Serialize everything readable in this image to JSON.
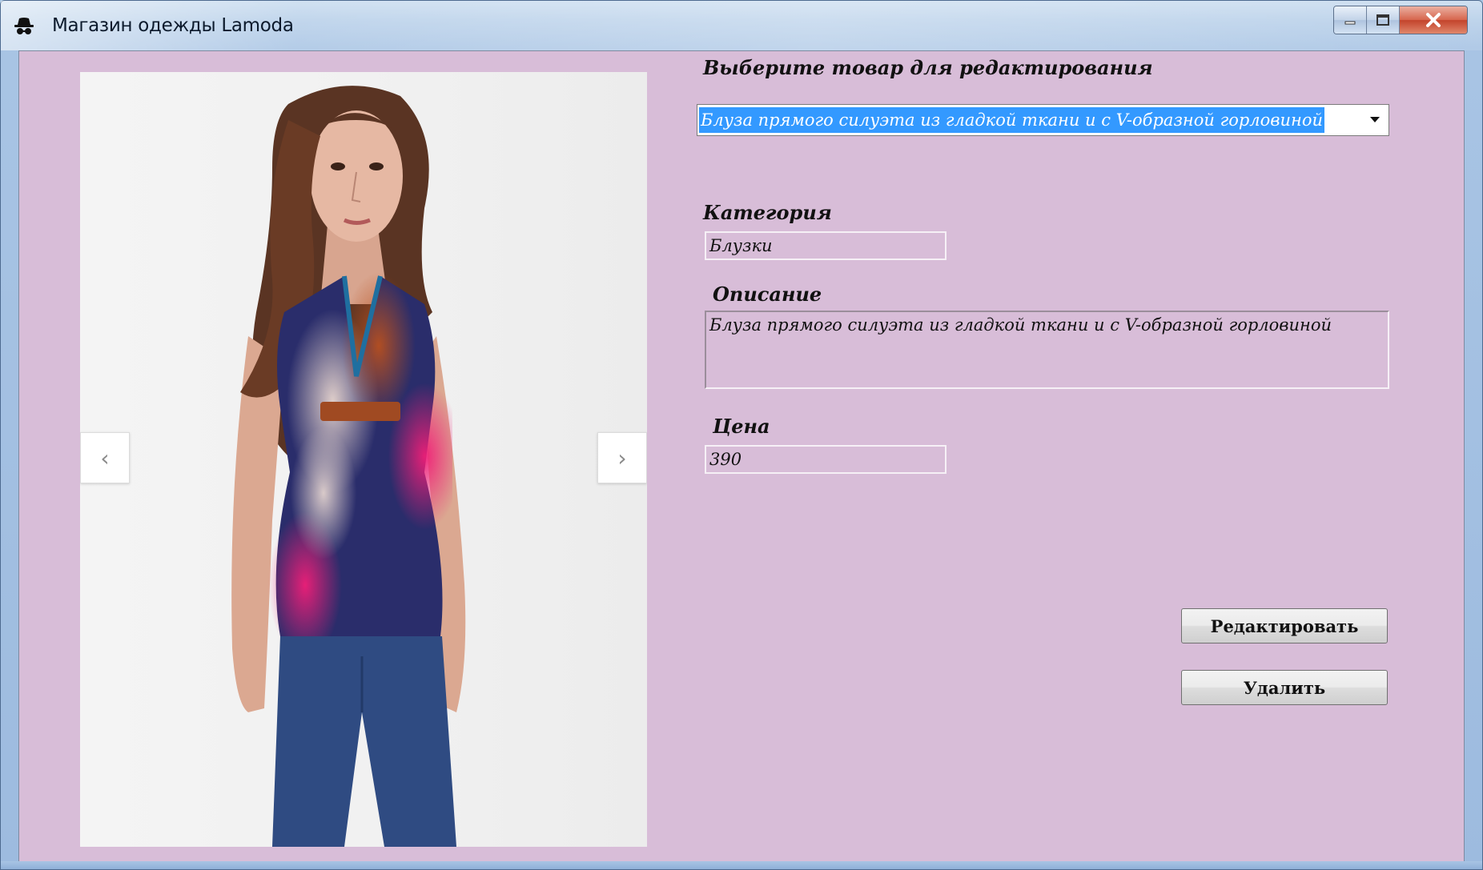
{
  "window": {
    "title": "Магазин одежды Lamoda",
    "icon": "spy-hat-icon",
    "controls": {
      "minimize": "minimize-icon",
      "maximize": "maximize-icon",
      "close": "close-icon"
    }
  },
  "product_image": {
    "prev_label": "‹",
    "next_label": "›"
  },
  "selector": {
    "label": "Выберите товар для редактирования",
    "selected": "Блуза прямого силуэта из гладкой ткани и с V-образной горловиной"
  },
  "category": {
    "label": "Категория",
    "value": "Блузки"
  },
  "description": {
    "label": "Описание",
    "value": "Блуза прямого силуэта из гладкой ткани и с V-образной горловиной"
  },
  "price": {
    "label": "Цена",
    "value": "390"
  },
  "actions": {
    "edit_label": "Редактировать",
    "delete_label": "Удалить"
  },
  "colors": {
    "client_background": "#d8bdd8",
    "selection": "#3399ff"
  }
}
